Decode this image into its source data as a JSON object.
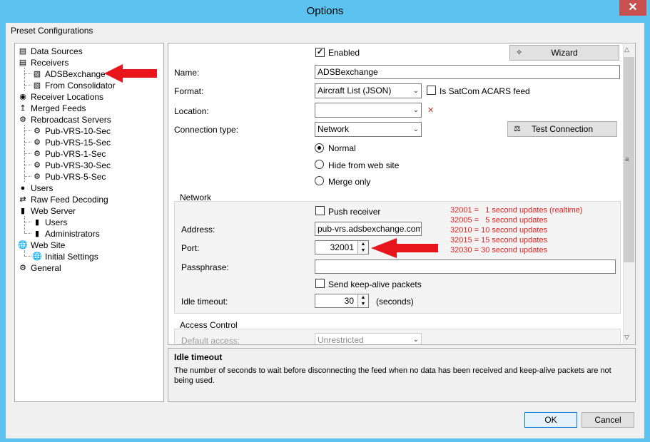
{
  "window": {
    "title": "Options",
    "close_label": "✕"
  },
  "header": {
    "preset_label": "Preset Configurations"
  },
  "tree": {
    "items": [
      {
        "label": "Data Sources",
        "icon": "document-icon"
      },
      {
        "label": "Receivers",
        "icon": "receiver-icon"
      },
      {
        "label": "ADSBexchange",
        "icon": "radio-icon"
      },
      {
        "label": "From Consolidator",
        "icon": "radio-icon"
      },
      {
        "label": "Receiver Locations",
        "icon": "pin-icon"
      },
      {
        "label": "Merged Feeds",
        "icon": "merge-icon"
      },
      {
        "label": "Rebroadcast Servers",
        "icon": "gears-icon"
      },
      {
        "label": "Pub-VRS-10-Sec",
        "icon": "gears-icon"
      },
      {
        "label": "Pub-VRS-15-Sec",
        "icon": "gears-icon"
      },
      {
        "label": "Pub-VRS-1-Sec",
        "icon": "gears-icon"
      },
      {
        "label": "Pub-VRS-30-Sec",
        "icon": "gears-icon"
      },
      {
        "label": "Pub-VRS-5-Sec",
        "icon": "gears-icon"
      },
      {
        "label": "Users",
        "icon": "user-icon"
      },
      {
        "label": "Raw Feed Decoding",
        "icon": "decode-icon"
      },
      {
        "label": "Web Server",
        "icon": "server-icon"
      },
      {
        "label": "Users",
        "icon": "server-icon"
      },
      {
        "label": "Administrators",
        "icon": "server-icon"
      },
      {
        "label": "Web Site",
        "icon": "globe-icon"
      },
      {
        "label": "Initial Settings",
        "icon": "globe-icon"
      },
      {
        "label": "General",
        "icon": "gear-icon"
      }
    ]
  },
  "form": {
    "enabled_label": "Enabled",
    "wizard_label": "Wizard",
    "name_label": "Name:",
    "name_value": "ADSBexchange",
    "format_label": "Format:",
    "format_value": "Aircraft List (JSON)",
    "satcom_label": "Is SatCom ACARS feed",
    "location_label": "Location:",
    "location_value": "",
    "clear_mark": "✕",
    "connection_type_label": "Connection type:",
    "connection_type_value": "Network",
    "test_connection_label": "Test Connection",
    "radio_normal": "Normal",
    "radio_hide": "Hide from web site",
    "radio_merge": "Merge only",
    "network_group_label": "Network",
    "push_receiver_label": "Push receiver",
    "address_label": "Address:",
    "address_value": "pub-vrs.adsbexchange.com",
    "port_label": "Port:",
    "port_value": "32001",
    "passphrase_label": "Passphrase:",
    "passphrase_value": "",
    "keepalive_label": "Send keep-alive packets",
    "idle_timeout_label": "Idle timeout:",
    "idle_timeout_value": "30",
    "seconds_label": "(seconds)",
    "access_group_label": "Access Control",
    "default_access_label": "Default access:",
    "default_access_value": "Unrestricted"
  },
  "annotations": {
    "port_notes": [
      "32001 =   1 second updates (realtime)",
      "32005 =   5 second updates",
      "32010 = 10 second updates",
      "32015 = 15 second updates",
      "32030 = 30 second updates"
    ],
    "accent_color": "#e02020"
  },
  "help": {
    "title": "Idle timeout",
    "text": "The number of seconds to wait before disconnecting the feed when no data has been received and keep-alive packets are not being used."
  },
  "footer": {
    "ok_label": "OK",
    "cancel_label": "Cancel"
  }
}
